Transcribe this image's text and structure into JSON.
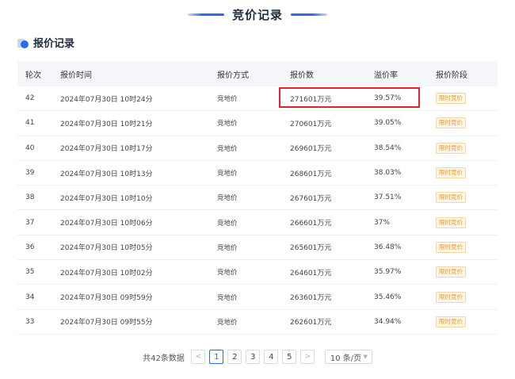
{
  "section": {
    "title": "竞价记录"
  },
  "panel": {
    "title": "报价记录"
  },
  "table": {
    "headers": [
      "轮次",
      "报价时间",
      "报价方式",
      "报价数",
      "溢价率",
      "报价阶段"
    ],
    "rows": [
      {
        "round": "42",
        "time": "2024年07月30日 10时24分",
        "method": "竞地价",
        "amount": "271601万元",
        "premium": "39.57%",
        "stage": "限时竞价"
      },
      {
        "round": "41",
        "time": "2024年07月30日 10时21分",
        "method": "竞地价",
        "amount": "270601万元",
        "premium": "39.05%",
        "stage": "限时竞价"
      },
      {
        "round": "40",
        "time": "2024年07月30日 10时17分",
        "method": "竞地价",
        "amount": "269601万元",
        "premium": "38.54%",
        "stage": "限时竞价"
      },
      {
        "round": "39",
        "time": "2024年07月30日 10时13分",
        "method": "竞地价",
        "amount": "268601万元",
        "premium": "38.03%",
        "stage": "限时竞价"
      },
      {
        "round": "38",
        "time": "2024年07月30日 10时10分",
        "method": "竞地价",
        "amount": "267601万元",
        "premium": "37.51%",
        "stage": "限时竞价"
      },
      {
        "round": "37",
        "time": "2024年07月30日 10时06分",
        "method": "竞地价",
        "amount": "266601万元",
        "premium": "37%",
        "stage": "限时竞价"
      },
      {
        "round": "36",
        "time": "2024年07月30日 10时05分",
        "method": "竞地价",
        "amount": "265601万元",
        "premium": "36.48%",
        "stage": "限时竞价"
      },
      {
        "round": "35",
        "time": "2024年07月30日 10时02分",
        "method": "竞地价",
        "amount": "264601万元",
        "premium": "35.97%",
        "stage": "限时竞价"
      },
      {
        "round": "34",
        "time": "2024年07月30日 09时59分",
        "method": "竞地价",
        "amount": "263601万元",
        "premium": "35.46%",
        "stage": "限时竞价"
      },
      {
        "round": "33",
        "time": "2024年07月30日 09时55分",
        "method": "竞地价",
        "amount": "262601万元",
        "premium": "34.94%",
        "stage": "限时竞价"
      }
    ]
  },
  "pagination": {
    "total": "共42条数据",
    "prev": "<",
    "next": ">",
    "pages": [
      "1",
      "2",
      "3",
      "4",
      "5"
    ],
    "current": "1",
    "page_size": "10 条/页"
  },
  "colors": {
    "accent": "#2f6be6",
    "highlight": "#e5212b",
    "tag_text": "#e89a2c"
  }
}
